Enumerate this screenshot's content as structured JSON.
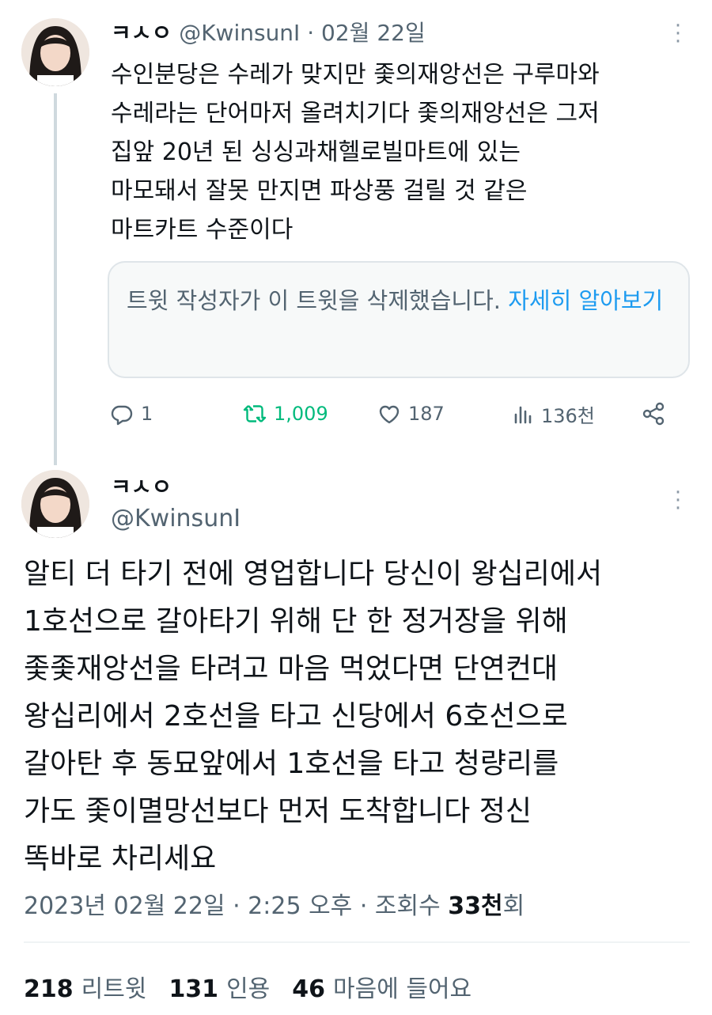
{
  "tweet1": {
    "display_name": "ㅋㅅㅇ",
    "handle": "@KwinsunI",
    "separator": "·",
    "date": "02월 22일",
    "body": "수인분당은 수레가 맞지만 좇의재앙선은 구루마와\n수레라는 단어마저 올려치기다 좇의재앙선은 그저\n집앞 20년 된 싱싱과채헬로빌마트에 있는\n마모돼서 잘못 만지면 파상풍 걸릴 것 같은\n마트카트 수준이다",
    "quote_deleted_text": "트윗 작성자가 이 트윗을 삭제했습니다.",
    "quote_learn_more": "자세히 알아보기",
    "actions": {
      "replies": "1",
      "retweets": "1,009",
      "likes": "187",
      "views": "136천"
    }
  },
  "tweet2": {
    "display_name": "ㅋㅅㅇ",
    "handle": "@KwinsunI",
    "body": "알티 더 타기 전에 영업합니다 당신이 왕십리에서\n1호선으로 갈아타기 위해 단 한 정거장을 위해\n좇좇재앙선을 타려고 마음 먹었다면 단연컨대\n왕십리에서 2호선을 타고 신당에서 6호선으로\n갈아탄 후 동묘앞에서 1호선을 타고 청량리를\n가도 좇이멸망선보다 먼저 도착합니다 정신\n똑바로 차리세요",
    "timestamp": "2023년 02월 22일 · 2:25 오후 · 조회수",
    "views_number": "33천",
    "views_suffix": "회",
    "stats": {
      "retweets_count": "218",
      "retweets_label": "리트윗",
      "quotes_count": "131",
      "quotes_label": "인용",
      "likes_count": "46",
      "likes_label": "마음에 들어요"
    }
  },
  "icons": [
    "more-icon",
    "reply-icon",
    "retweet-icon",
    "like-icon",
    "views-icon",
    "share-icon"
  ],
  "colors": {
    "accent": "#1d9bf0",
    "retweet_green": "#00ba7c",
    "muted": "#536471",
    "text": "#0f1419"
  }
}
